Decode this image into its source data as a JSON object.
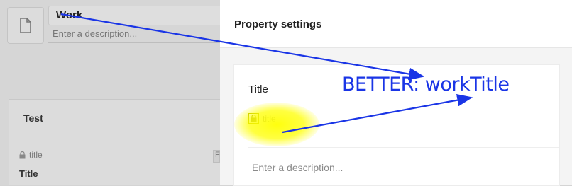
{
  "editor": {
    "name_value": "Work",
    "description_placeholder": "Enter a description...",
    "card": {
      "title": "Test",
      "field_key": "title",
      "field_label": "Title",
      "edge_text": "F"
    }
  },
  "panel": {
    "header_title": "Property settings",
    "property_title": "Title",
    "property_key": "title",
    "description_placeholder": "Enter a description..."
  },
  "annotation": {
    "text": "BETTER: workTitle",
    "color": "#1a35e6",
    "highlight_color": "#ffff00"
  },
  "icons": [
    "document-icon",
    "lock-icon"
  ]
}
